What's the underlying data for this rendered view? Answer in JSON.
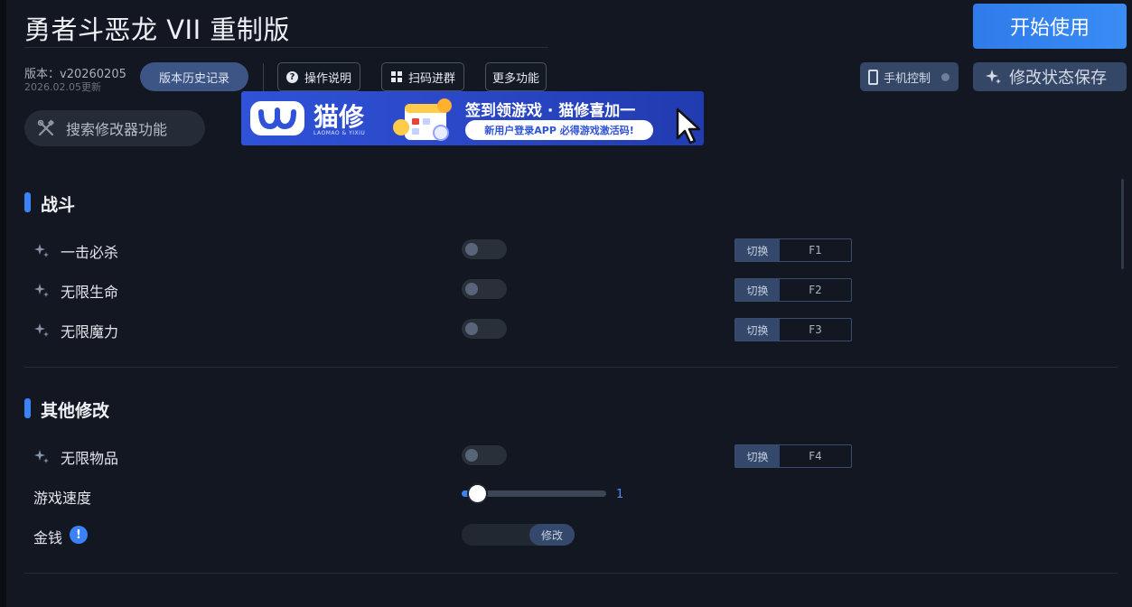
{
  "app": {
    "title": "勇者斗恶龙 VII 重制版",
    "start_label": "开始使用",
    "version": "版本：v20260205",
    "version_date": "2026.02.05更新",
    "history_label": "版本历史记录"
  },
  "toolbar": {
    "help_label": "操作说明",
    "qr_label": "扫码进群",
    "more_label": "更多功能",
    "phone_label": "手机控制",
    "save_label": "修改状态保存"
  },
  "search": {
    "placeholder": "搜索修改器功能",
    "icon": "tools-icon"
  },
  "banner": {
    "brand": "猫修",
    "brand_sub": "LAOMAO & YIXIU",
    "headline": "签到领游戏 · 猫修喜加一",
    "cta": "新用户登录APP  必得游戏激活码!",
    "brand_color": "#2f52d8"
  },
  "colors": {
    "accent": "#3b82f6",
    "background": "#121721"
  },
  "sections": [
    {
      "title": "战斗",
      "items": [
        {
          "label": "一击必杀",
          "enabled": false,
          "hotkey_action": "切换",
          "hotkey": "F1"
        },
        {
          "label": "无限生命",
          "enabled": false,
          "hotkey_action": "切换",
          "hotkey": "F2"
        },
        {
          "label": "无限魔力",
          "enabled": false,
          "hotkey_action": "切换",
          "hotkey": "F3"
        }
      ]
    },
    {
      "title": "其他修改",
      "items": [
        {
          "label": "无限物品",
          "enabled": false,
          "hotkey_action": "切换",
          "hotkey": "F4"
        }
      ],
      "speed": {
        "label": "游戏速度",
        "value": "1",
        "fraction": 0.1
      },
      "money": {
        "label": "金钱",
        "info_icon": "!",
        "button_label": "修改"
      }
    }
  ]
}
